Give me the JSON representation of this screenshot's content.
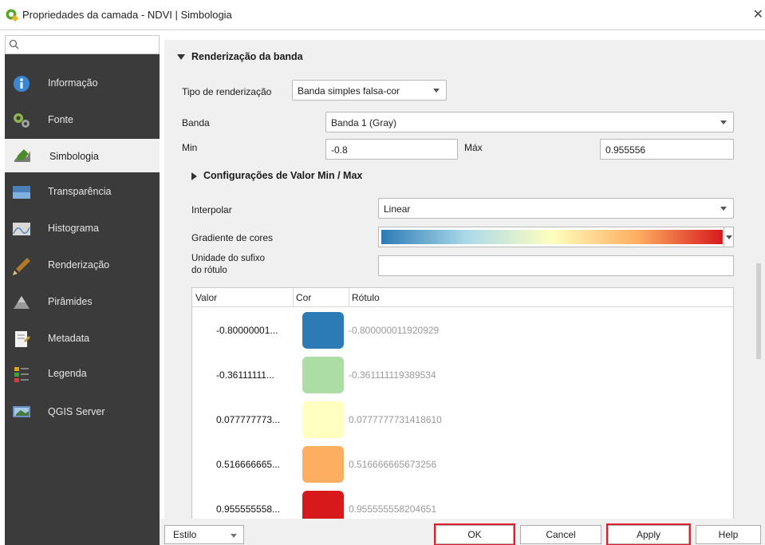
{
  "window": {
    "title": "Propriedades da camada - NDVI | Simbologia",
    "close_glyph": "✕"
  },
  "sidebar": {
    "search_placeholder": "",
    "items": [
      {
        "label": "Informação",
        "icon": "info-icon"
      },
      {
        "label": "Fonte",
        "icon": "source-icon"
      },
      {
        "label": "Simbologia",
        "icon": "symbology-icon",
        "active": true
      },
      {
        "label": "Transparência",
        "icon": "transparency-icon"
      },
      {
        "label": "Histograma",
        "icon": "histogram-icon"
      },
      {
        "label": "Renderização",
        "icon": "rendering-icon"
      },
      {
        "label": "Pirâmides",
        "icon": "pyramids-icon"
      },
      {
        "label": "Metadata",
        "icon": "metadata-icon"
      },
      {
        "label": "Legenda",
        "icon": "legend-icon"
      },
      {
        "label": "QGIS Server",
        "icon": "qgis-server-icon"
      }
    ]
  },
  "band_rendering": {
    "section_title": "Renderização da banda",
    "render_type_label": "Tipo de renderização",
    "render_type_value": "Banda simples falsa-cor",
    "band_label": "Banda",
    "band_value": "Banda 1 (Gray)",
    "min_label": "Min",
    "min_value": "-0.8",
    "max_label": "Máx",
    "max_value": "0.955556",
    "minmax_settings_label": "Configurações de Valor Min / Max",
    "interpolate_label": "Interpolar",
    "interpolate_value": "Linear",
    "color_ramp_label": "Gradiente de cores",
    "suffix_label_line1": "Unidade do sufixo",
    "suffix_label_line2": "do rótulo",
    "suffix_value": ""
  },
  "table": {
    "headers": [
      "Valor",
      "Cor",
      "Rótulo"
    ],
    "rows": [
      {
        "value": "-0.80000001...",
        "color": "#2c7bb6",
        "label": "-0.800000011920929"
      },
      {
        "value": "-0.36111111...",
        "color": "#abdda4",
        "label": "-0.361111119389534"
      },
      {
        "value": "0.077777773...",
        "color": "#ffffbf",
        "label": "0.0777777731418610"
      },
      {
        "value": "0.516666665...",
        "color": "#fdae61",
        "label": "0.516666665673256"
      },
      {
        "value": "0.955555558...",
        "color": "#d7191c",
        "label": "0.955555558204651"
      }
    ]
  },
  "buttons": {
    "style": "Estilo",
    "ok": "OK",
    "cancel": "Cancel",
    "apply": "Apply",
    "help": "Help"
  },
  "colors": {
    "highlight": "#e0202e",
    "sidebar_bg": "#3b3b3b"
  }
}
